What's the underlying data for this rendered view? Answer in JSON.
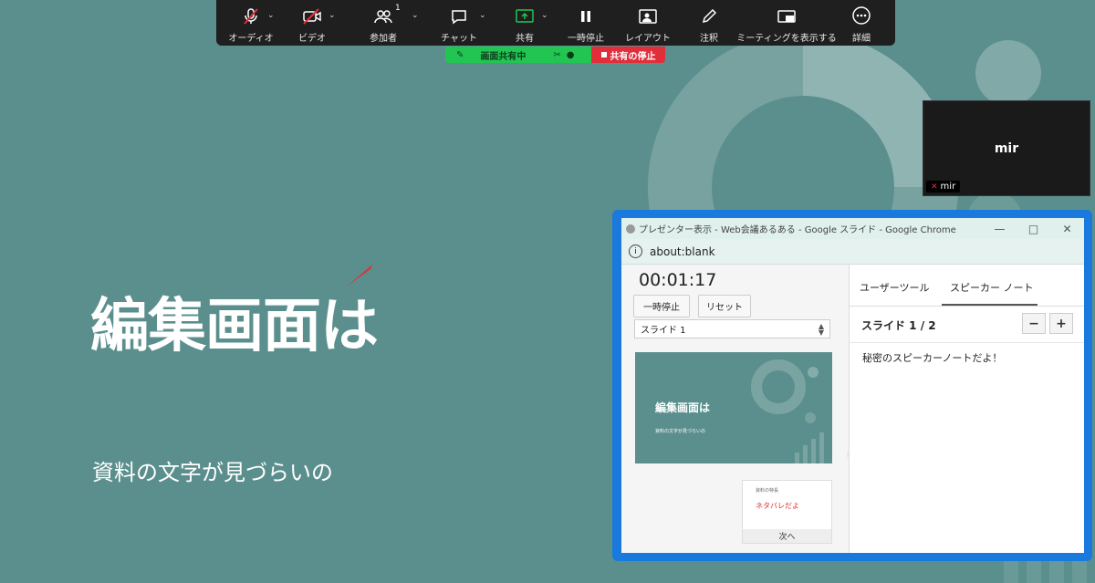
{
  "toolbar": {
    "items": [
      {
        "label": "オーディオ",
        "icon": "microphone-muted-icon"
      },
      {
        "label": "ビデオ",
        "icon": "camera-off-icon"
      },
      {
        "label": "参加者",
        "icon": "participants-icon",
        "badge": "1"
      },
      {
        "label": "チャット",
        "icon": "chat-icon"
      },
      {
        "label": "共有",
        "icon": "share-screen-icon"
      },
      {
        "label": "一時停止",
        "icon": "pause-icon"
      },
      {
        "label": "レイアウト",
        "icon": "layout-icon"
      },
      {
        "label": "注釈",
        "icon": "annotate-pen-icon"
      },
      {
        "label": "ミーティングを表示する",
        "icon": "show-meeting-icon"
      },
      {
        "label": "詳細",
        "icon": "more-icon"
      }
    ],
    "colors": {
      "background": "#1f1f1f",
      "muted_red": "#e02f3b",
      "share_green": "#23c552"
    }
  },
  "share_status": {
    "sharing_label": "画面共有中",
    "stop_label": "共有の停止"
  },
  "slide": {
    "title": "編集画面は",
    "subtitle": "資料の文字が見づらいの",
    "background": "#5b8f8d"
  },
  "video_tile": {
    "name": "mir",
    "tag": "mir"
  },
  "browser": {
    "window_title": "プレゼンター表示 - Web会議あるある - Google スライド - Google Chrome",
    "address": "about:blank",
    "timer": "00:01:17",
    "pause_label": "一時停止",
    "reset_label": "リセット",
    "slide_select": "スライド 1",
    "thumb_title": "編集画面は",
    "thumb_sub": "資料の文字が見づらいの",
    "next_small": "資料の特長",
    "next_red": "ネタバレだよ",
    "next_label": "次へ",
    "tab_tools": "ユーザーツール",
    "tab_notes": "スピーカー ノート",
    "slide_counter": "スライド 1 / 2",
    "zoom_out": "−",
    "zoom_in": "+",
    "note_text": "秘密のスピーカーノートだよ！"
  }
}
